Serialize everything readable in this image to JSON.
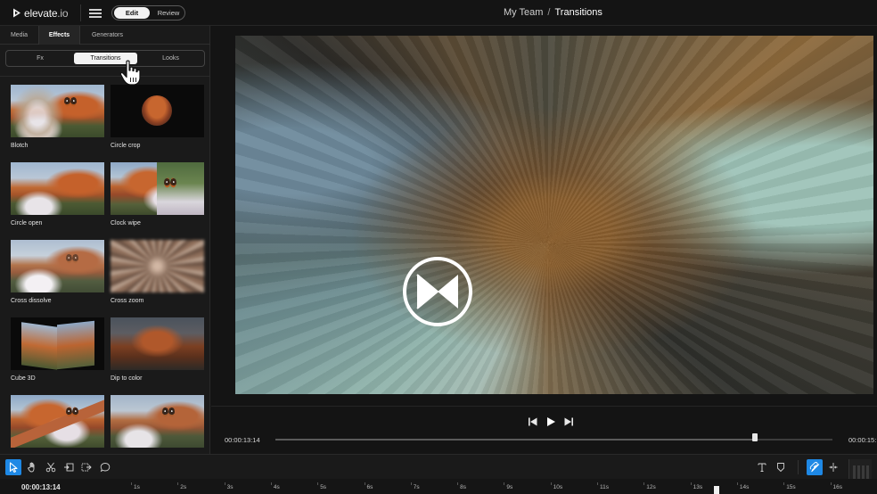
{
  "app": {
    "logo_main": "elevate",
    "logo_suffix": ".io",
    "modes": {
      "edit": "Edit",
      "review": "Review",
      "selected": "Edit"
    },
    "breadcrumb": {
      "team": "My Team",
      "separator": "/",
      "page": "Transitions"
    }
  },
  "left_panel": {
    "tabs": [
      {
        "label": "Media"
      },
      {
        "label": "Effects",
        "active": true
      },
      {
        "label": "Generators"
      }
    ],
    "subtabs": [
      {
        "label": "Fx"
      },
      {
        "label": "Transitions",
        "active": true
      },
      {
        "label": "Looks"
      }
    ],
    "transitions": [
      {
        "label": "Blotch"
      },
      {
        "label": "Circle crop"
      },
      {
        "label": "Circle open"
      },
      {
        "label": "Clock wipe"
      },
      {
        "label": "Cross dissolve"
      },
      {
        "label": "Cross zoom"
      },
      {
        "label": "Cube 3D"
      },
      {
        "label": "Dip to color"
      },
      {
        "label": ""
      },
      {
        "label": ""
      }
    ]
  },
  "player": {
    "current_time": "00:00:13:14",
    "duration": "00:00:15:",
    "progress": 0.86,
    "icons": [
      "skip-back-icon",
      "play-icon",
      "skip-forward-icon",
      "transition-bowtie-icon"
    ]
  },
  "timeline": {
    "timecode": "00:00:13:14",
    "ticks": [
      "1s",
      "2s",
      "3s",
      "4s",
      "5s",
      "6s",
      "7s",
      "8s",
      "9s",
      "10s",
      "11s",
      "12s",
      "13s",
      "14s",
      "15s",
      "16s"
    ],
    "tools": [
      "select-icon",
      "hand-icon",
      "cut-icon",
      "trim-in-icon",
      "trim-out-icon",
      "comment-icon",
      "text-icon",
      "marker-icon",
      "magnet-icon",
      "split-icon"
    ],
    "accent": "#1e88e5"
  }
}
